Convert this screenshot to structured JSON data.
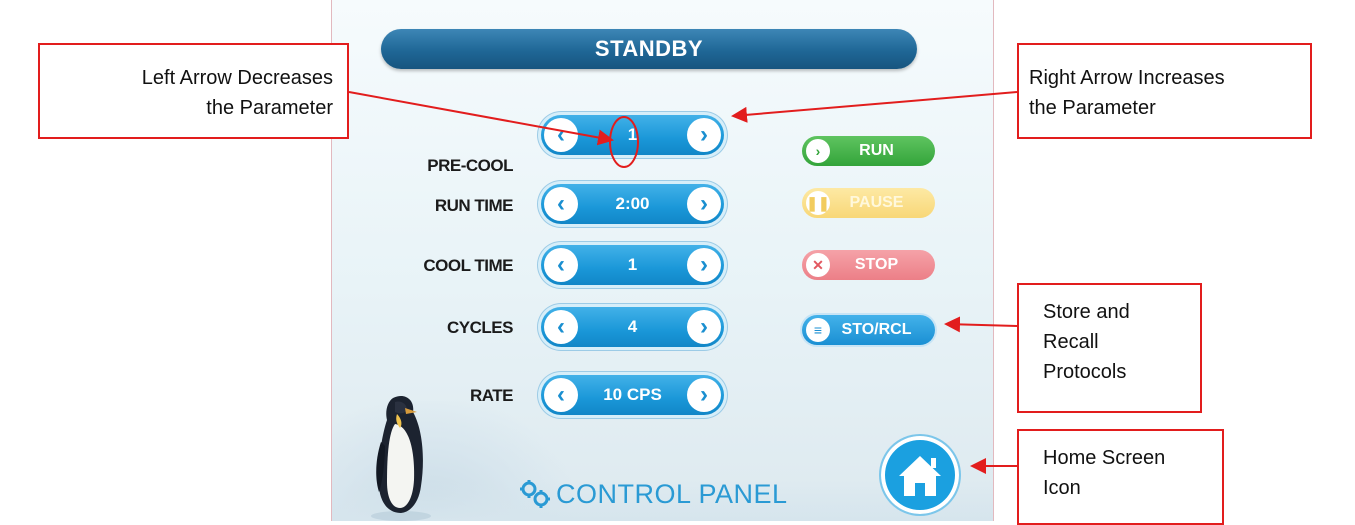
{
  "panel": {
    "status": "STANDBY",
    "params": [
      {
        "label": "PRE-COOL",
        "value": "1"
      },
      {
        "label": "RUN TIME",
        "value": "2:00"
      },
      {
        "label": "COOL TIME",
        "value": "1"
      },
      {
        "label": "CYCLES",
        "value": "4"
      },
      {
        "label": "RATE",
        "value": "10 CPS"
      }
    ],
    "buttons": {
      "run": "RUN",
      "pause": "PAUSE",
      "stop": "STOP",
      "sto_rcl": "STO/RCL"
    },
    "title": "CONTROL PANEL",
    "icons": {
      "left_arrow": "chevron-left-icon",
      "right_arrow": "chevron-right-icon",
      "home": "home-icon",
      "gears": "gears-icon"
    }
  },
  "callouts": {
    "left_arrow": [
      "Left Arrow Decreases",
      "the Parameter"
    ],
    "right_arrow": [
      "Right Arrow Increases",
      "the Parameter"
    ],
    "store": [
      "Store and",
      "Recall",
      "Protocols"
    ],
    "home": [
      "Home Screen",
      "Icon"
    ]
  },
  "colors": {
    "annotation": "#e21d1d",
    "status_bar": "#1f6796",
    "stepper": "#1a97d8",
    "run": "#33a43a",
    "pause": "#f8d777",
    "stop": "#ec7f87",
    "home": "#1ba0e0"
  }
}
